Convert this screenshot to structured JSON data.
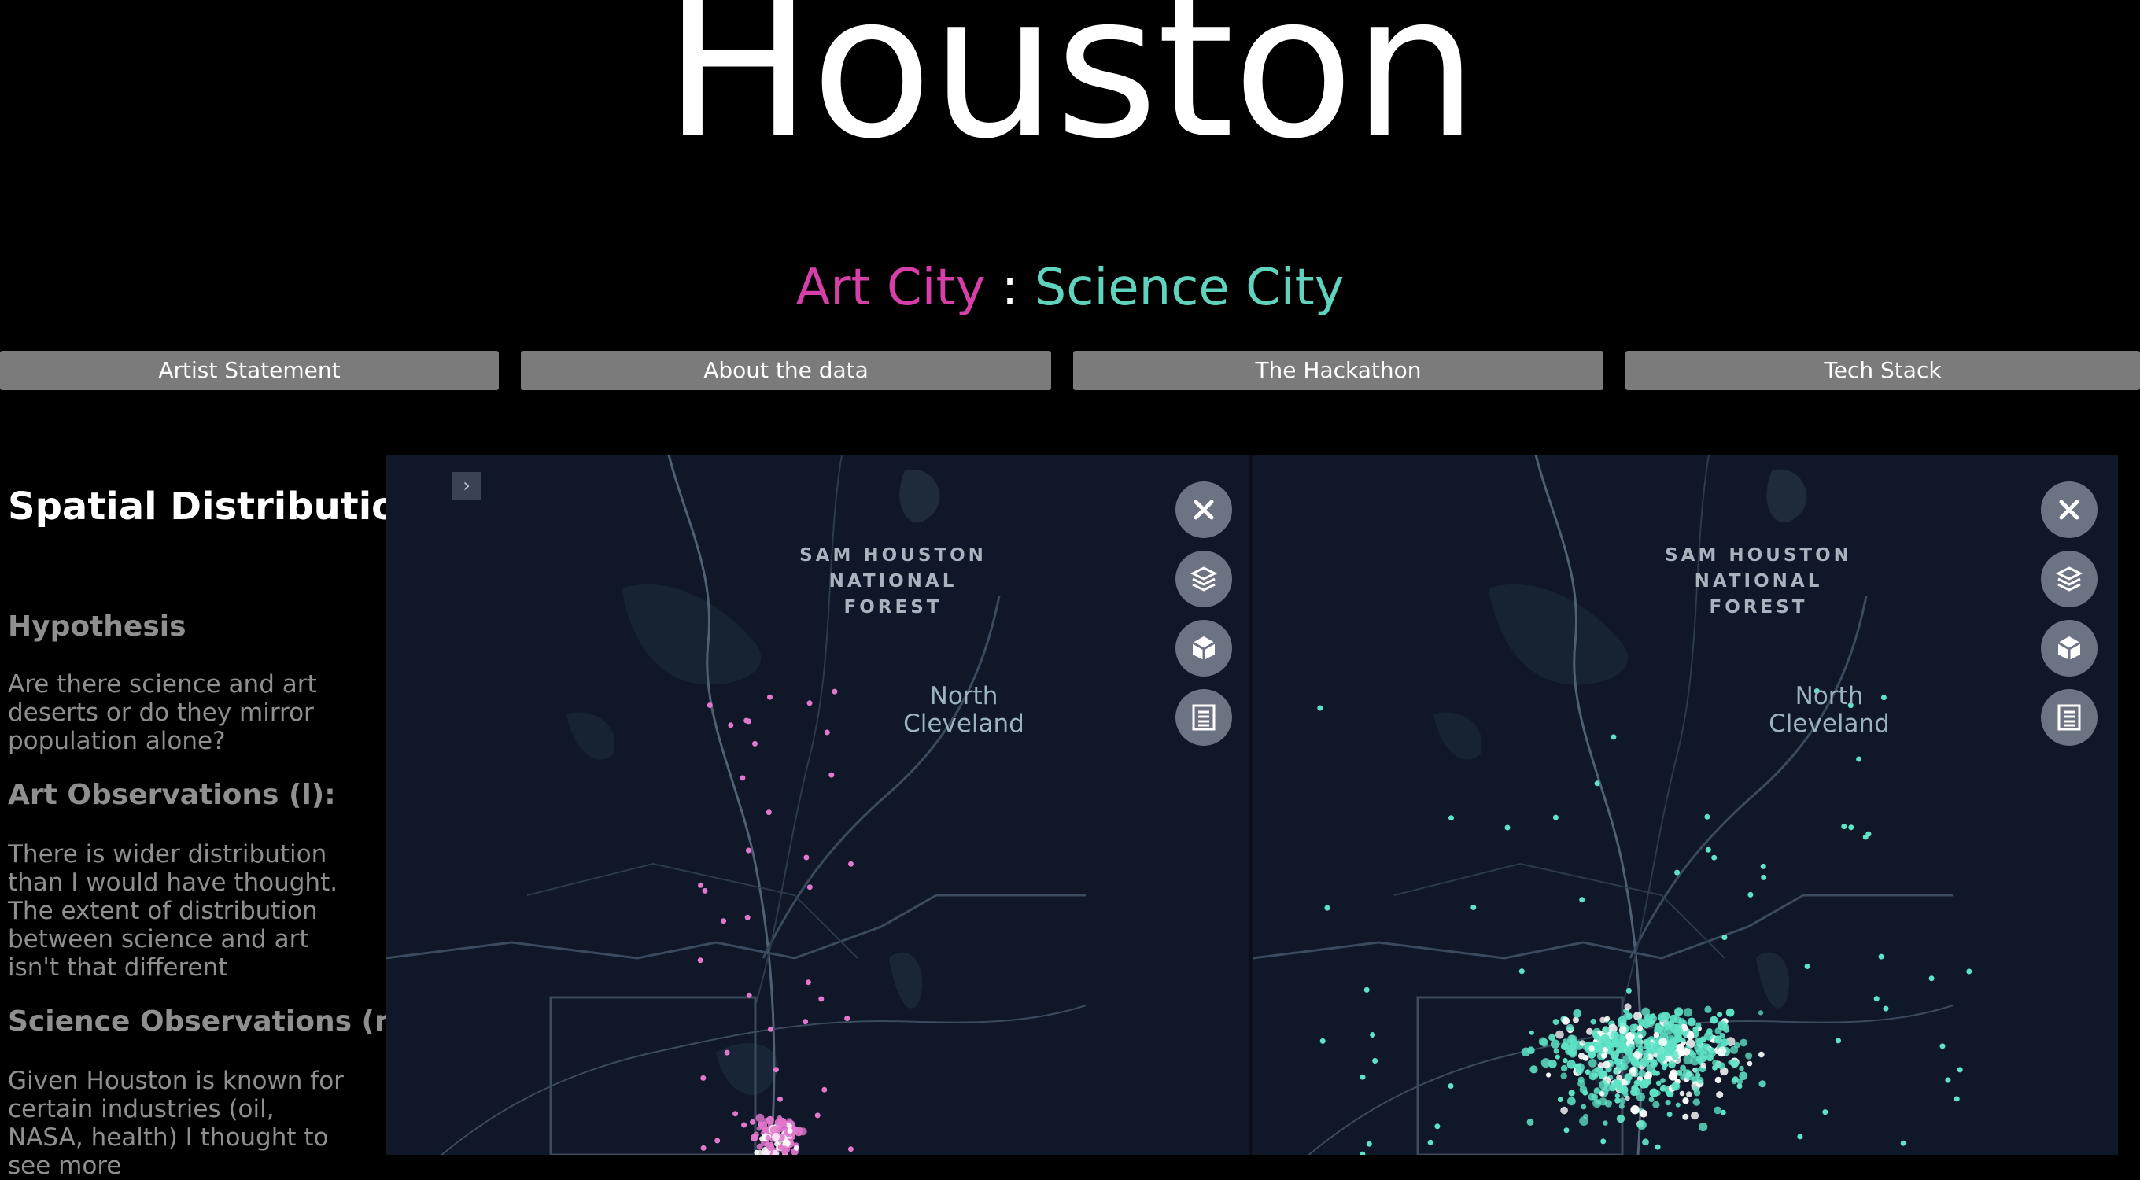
{
  "header": {
    "title": "Houston",
    "subtitle_art": "Art City",
    "subtitle_sep": ":",
    "subtitle_sci": "Science City"
  },
  "nav": [
    {
      "label": "Artist Statement"
    },
    {
      "label": "About the data"
    },
    {
      "label": "The Hackathon"
    },
    {
      "label": "Tech Stack"
    }
  ],
  "sidebar": {
    "section_title": "Spatial Distribution",
    "hypothesis_heading": "Hypothesis",
    "hypothesis_text": "Are there science and art deserts or do they mirror population alone?",
    "art_heading": "Art Observations (l):",
    "art_text": "There is wider distribution than I would have thought. The extent of distribution between science and art isn't that different",
    "sci_heading": "Science Observations (r):",
    "sci_text": "Given Houston is known for certain industries (oil, NASA, health) I thought to see more"
  },
  "maps": [
    {
      "forest_label": "SAM HOUSTON\nNATIONAL\nFOREST",
      "city_label": "North\nCleveland",
      "point_color": "#e178cc",
      "highlight_color": "#ffffff"
    },
    {
      "forest_label": "SAM HOUSTON\nNATIONAL\nFOREST",
      "city_label": "North\nCleveland",
      "point_color": "#5fe3c6",
      "highlight_color": "#ffffff"
    }
  ],
  "map_controls": [
    {
      "icon": "close-icon"
    },
    {
      "icon": "layers-icon"
    },
    {
      "icon": "3d-cube-icon"
    },
    {
      "icon": "legend-list-icon"
    }
  ],
  "colors": {
    "art": "#d63ea8",
    "science": "#5fd3bd",
    "nav_button": "#7b7b7b",
    "map_background": "#0f1728"
  }
}
